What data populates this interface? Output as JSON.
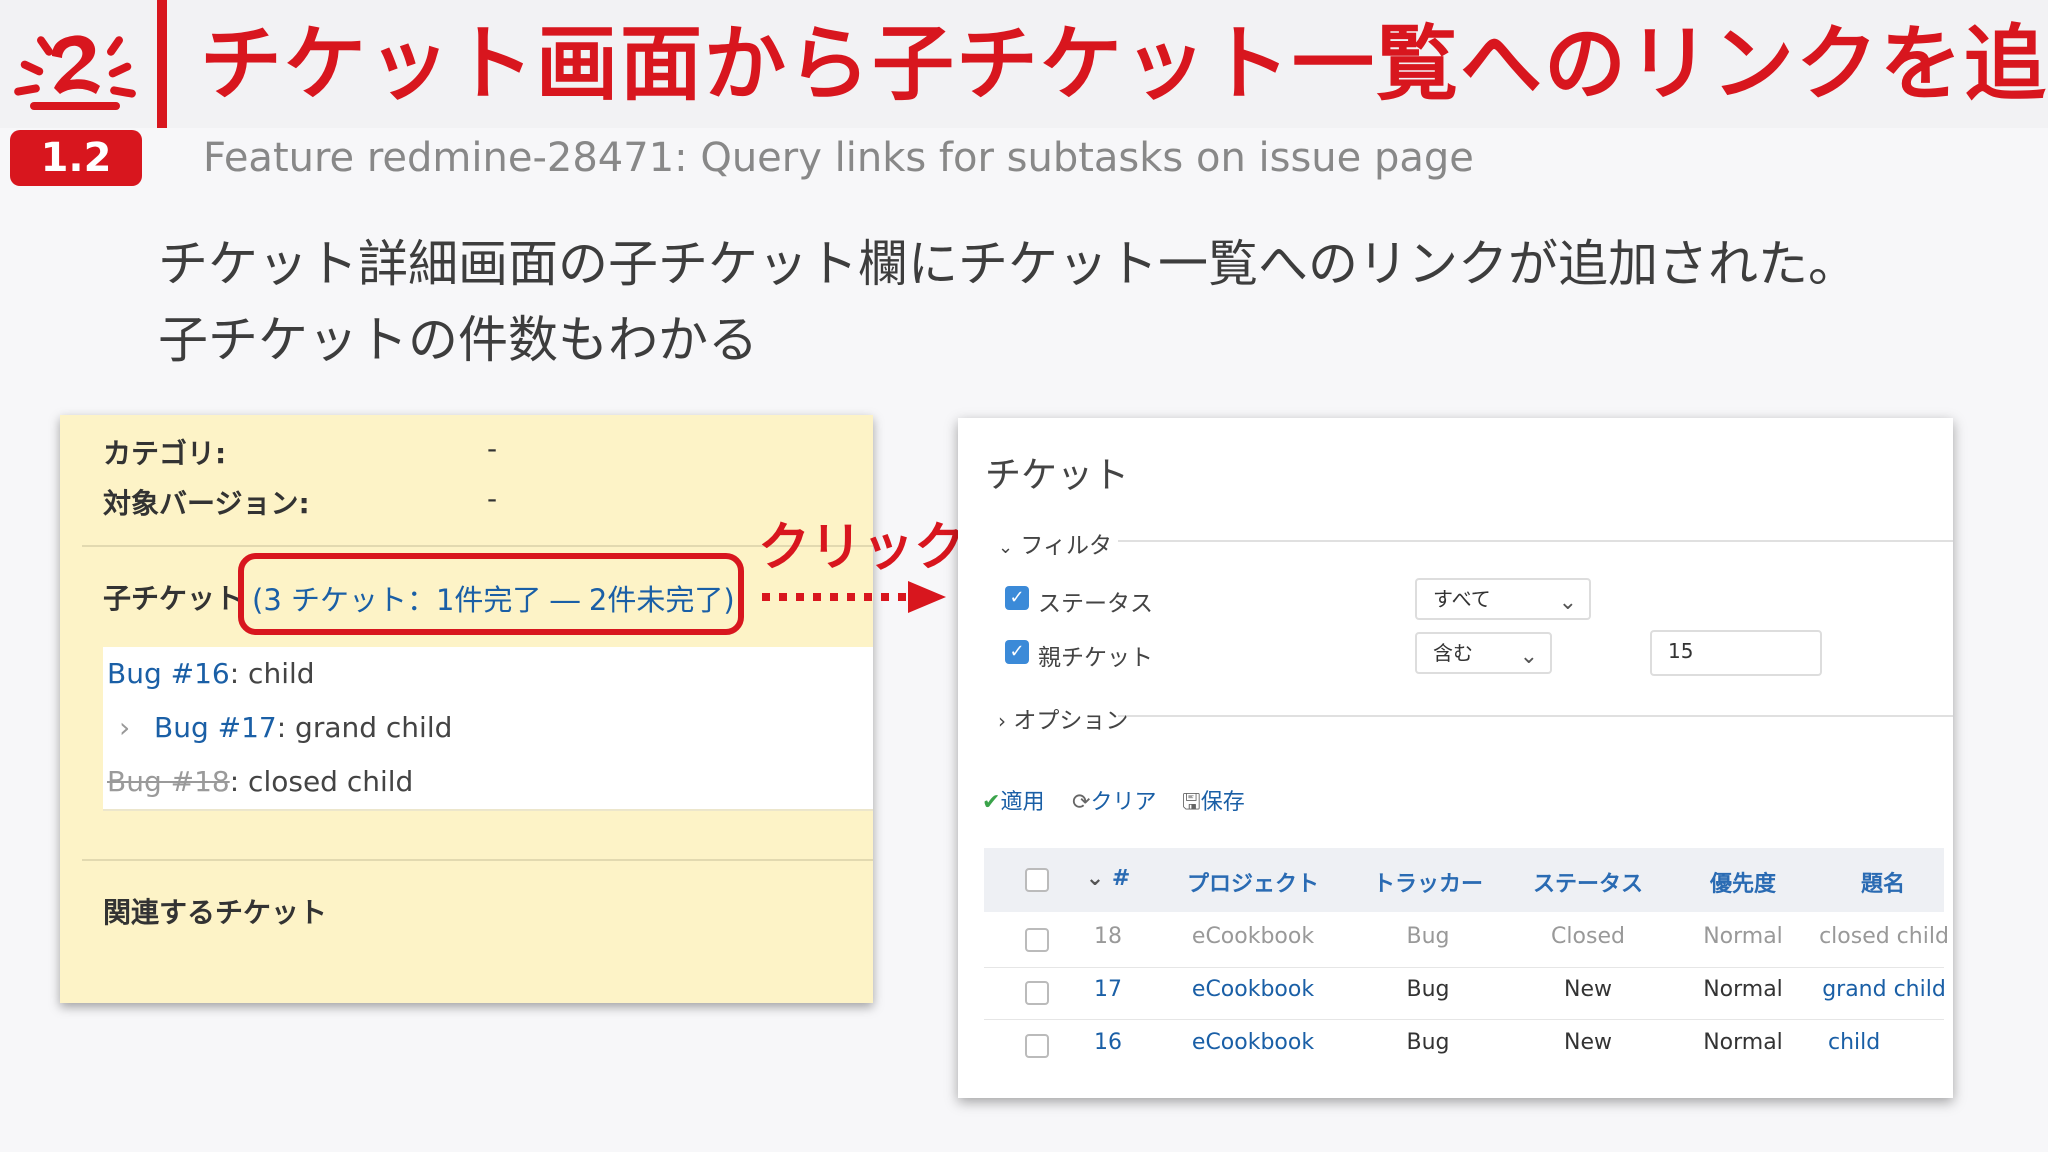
{
  "header": {
    "title": "チケット画面から子チケット一覧へのリンクを追加",
    "version_badge": "1.2",
    "subtitle": "Feature redmine-28471: Query links for subtasks on issue page",
    "brand_color": "#d8161e"
  },
  "description": {
    "line1": "チケット詳細画面の子チケット欄にチケット一覧へのリンクが追加された。",
    "line2": "子チケットの件数もわかる"
  },
  "issue_panel": {
    "category_label": "カテゴリ:",
    "category_value": "-",
    "version_label": "対象バージョン:",
    "version_value": "-",
    "subtasks_label": "子チケット",
    "subtasks_link": "(3 チケット：1件完了 ― 2件未完了)",
    "subtasks": [
      {
        "tracker_id": "Bug #16",
        "subject": ": child"
      },
      {
        "tracker_id": "Bug #17",
        "subject": ": grand child"
      },
      {
        "tracker_id": "Bug #18",
        "subject": ": closed child"
      }
    ],
    "related_label": "関連するチケット"
  },
  "callout": {
    "click_label": "クリック"
  },
  "issues_panel": {
    "title": "チケット",
    "filter_legend": "フィルタ",
    "filters": [
      {
        "label": "ステータス",
        "operator": "すべて",
        "value": ""
      },
      {
        "label": "親チケット",
        "operator": "含む",
        "value": "15"
      }
    ],
    "options_legend": "オプション",
    "actions": {
      "apply": "適用",
      "clear": "クリア",
      "save": "保存"
    },
    "columns": [
      "#",
      "プロジェクト",
      "トラッカー",
      "ステータス",
      "優先度",
      "題名"
    ],
    "rows": [
      {
        "id": "18",
        "project": "eCookbook",
        "tracker": "Bug",
        "status": "Closed",
        "priority": "Normal",
        "subject": "closed child"
      },
      {
        "id": "17",
        "project": "eCookbook",
        "tracker": "Bug",
        "status": "New",
        "priority": "Normal",
        "subject": "grand child"
      },
      {
        "id": "16",
        "project": "eCookbook",
        "tracker": "Bug",
        "status": "New",
        "priority": "Normal",
        "subject": "child"
      }
    ]
  }
}
